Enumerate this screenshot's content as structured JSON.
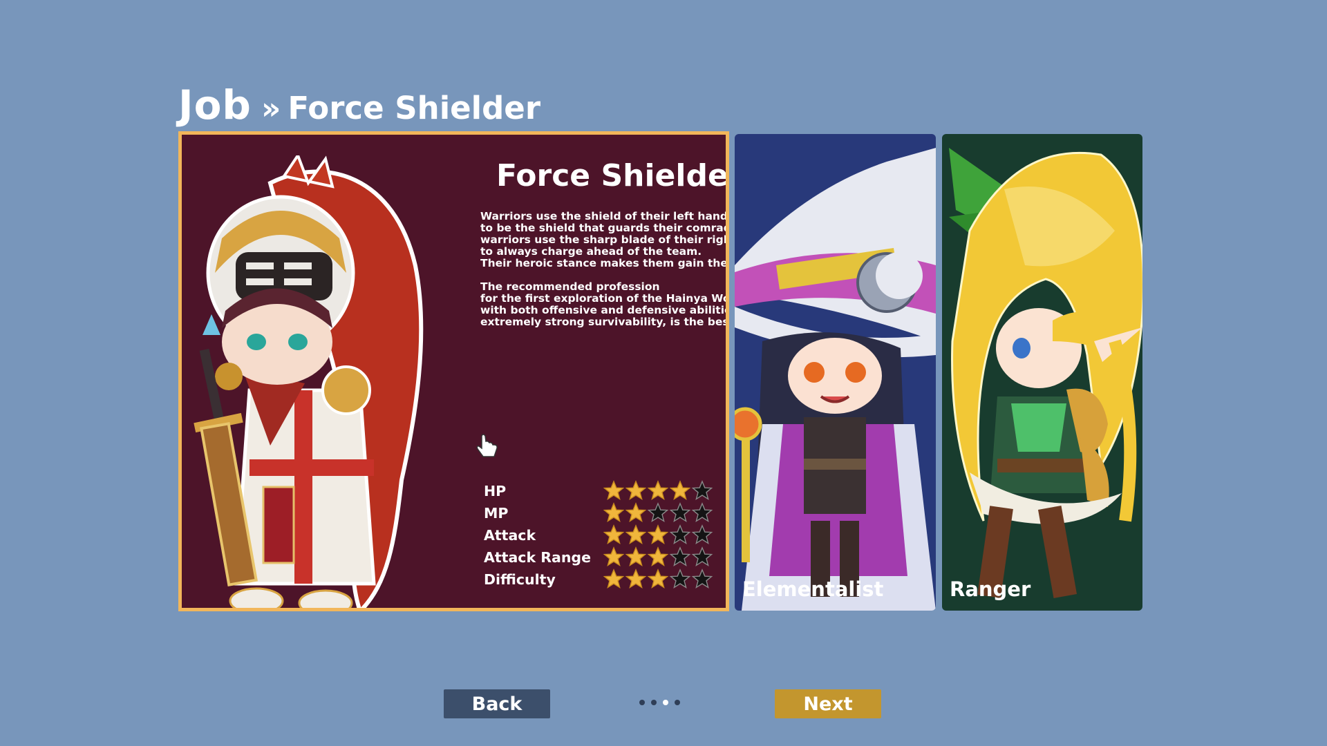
{
  "breadcrumb": {
    "root": "Job",
    "separator": "»",
    "current": "Force Shielder"
  },
  "selected_job": {
    "title": "Force Shielder",
    "description_lines": [
      "Warriors use the shield of their left hand",
      "to be the shield that guards their comrades.",
      "warriors use the sharp blade of their right ha",
      "to always charge ahead of the team.",
      "Their heroic stance makes them gain the res",
      "",
      "The recommended profession",
      "for the first exploration of the Hainya World,",
      "with both offensive and defensive abilities,",
      "extremely strong survivability, is the best ch"
    ],
    "stats": [
      {
        "label": "HP",
        "rating": 4,
        "max": 5
      },
      {
        "label": "MP",
        "rating": 2,
        "max": 5
      },
      {
        "label": "Attack",
        "rating": 3,
        "max": 5
      },
      {
        "label": "Attack Range",
        "rating": 3,
        "max": 5
      },
      {
        "label": "Difficulty",
        "rating": 3,
        "max": 5
      }
    ]
  },
  "other_jobs": [
    {
      "name": "Elementalist"
    },
    {
      "name": "Ranger"
    }
  ],
  "buttons": {
    "back": "Back",
    "next": "Next"
  },
  "pagination": {
    "total": 4,
    "current": 3
  },
  "colors": {
    "background": "#7896bb",
    "selected_card_bg": "#4d1429",
    "selected_border": "#f2b65a",
    "star_filled": "#f0b63c",
    "star_empty": "#141414",
    "elementalist_bg": "#28397a",
    "ranger_bg": "#183c2e",
    "back_button": "#3c4f6b",
    "next_button": "#c3962e"
  }
}
